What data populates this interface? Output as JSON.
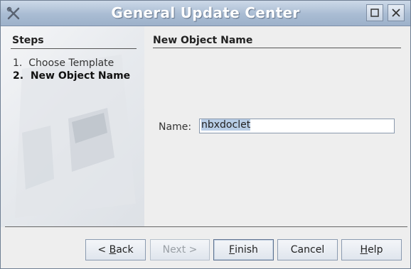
{
  "window": {
    "title": "General Update Center",
    "icon": "tools-icon",
    "controls": [
      "maximize-icon",
      "close-icon"
    ]
  },
  "steps": {
    "title": "Steps",
    "items": [
      {
        "num": "1.",
        "label": "Choose Template",
        "current": false
      },
      {
        "num": "2.",
        "label": "New Object Name",
        "current": true
      }
    ]
  },
  "content": {
    "title": "New Object Name",
    "name_label_mnemonic": "N",
    "name_label_rest": "ame:",
    "name_value": "nbxdoclet"
  },
  "buttons": {
    "back_prefix": "< ",
    "back_mnemonic": "B",
    "back_rest": "ack",
    "next_label": "Next >",
    "finish_mnemonic": "F",
    "finish_rest": "inish",
    "cancel_label": "Cancel",
    "help_mnemonic": "H",
    "help_rest": "elp"
  },
  "colors": {
    "title_bar": "#a9bcd3",
    "selection": "#b8cde6",
    "window_bg": "#eeeeee"
  }
}
